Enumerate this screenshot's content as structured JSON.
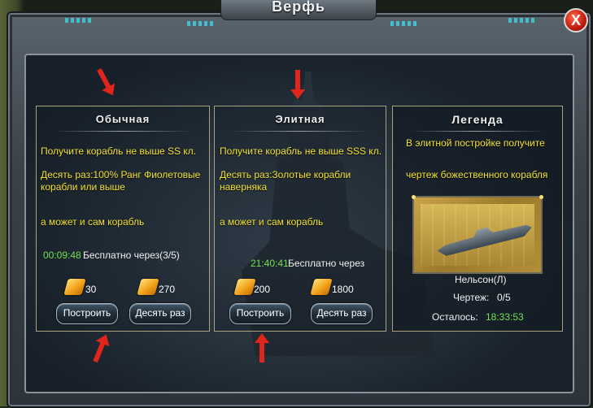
{
  "window": {
    "title": "Верфь",
    "close_label": "X"
  },
  "panels": [
    {
      "title": "Обычная",
      "line1": "Получите корабль не выше SS кл.",
      "line2": "Десять раз:100% Ранг Фиолетовые корабли или выше",
      "line3": "а может и сам корабль",
      "timer": "00:09:48",
      "free_text": "Бесплатно через(3/5)",
      "cost_single": "30",
      "cost_ten": "270",
      "build_label": "Построить",
      "ten_label": "Десять раз"
    },
    {
      "title": "Элитная",
      "line1": "Получите корабль не выше SSS кл.",
      "line2": "Десять раз:Золотые корабли наверняка",
      "line3": "а может и сам корабль",
      "timer": "21:40:41",
      "free_text": "Бесплатно через",
      "cost_single": "200",
      "cost_ten": "1800",
      "build_label": "Построить",
      "ten_label": "Десять раз"
    }
  ],
  "legend": {
    "title": "Легенда",
    "line1": "В элитной постройке получите",
    "line2": "чертеж божественного корабля",
    "ship_name": "Нельсон(Л)",
    "blueprint_label": "Чертеж:",
    "blueprint_count": "0/5",
    "remaining_label": "Осталось:",
    "remaining_time": "18:33:53"
  },
  "colors": {
    "highlight_yellow": "#f3e235",
    "timer_green": "#6fe24f",
    "arrow_red": "#e2251c"
  },
  "icons": [
    "ticket-icon",
    "close-icon",
    "arrow-icon"
  ]
}
